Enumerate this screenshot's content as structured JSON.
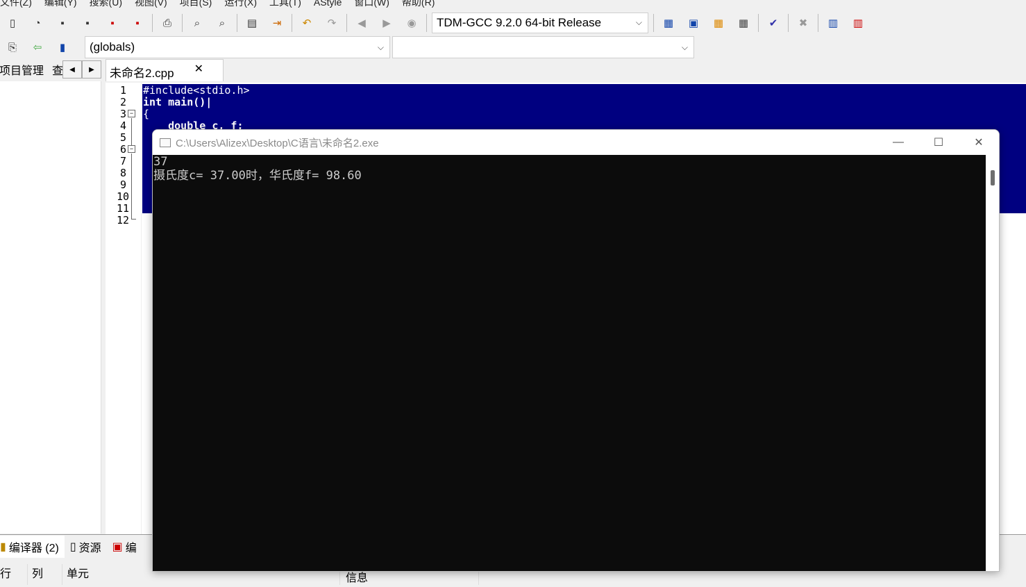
{
  "menu": [
    "文件(Z)",
    "编辑(Y)",
    "搜索(U)",
    "视图(V)",
    "项目(S)",
    "运行(X)",
    "工具(T)",
    "AStyle",
    "窗口(W)",
    "帮助(R)"
  ],
  "toolbar": {
    "compiler": "TDM-GCC 9.2.0 64-bit Release",
    "scope": "(globals)"
  },
  "left_panel": {
    "tab_project": "项目管理",
    "tab_class_partial": "查"
  },
  "editor": {
    "tab_title": "未命名2.cpp",
    "close_glyph": "✕",
    "line_numbers": [
      "1",
      "2",
      "3",
      "4",
      "5",
      "6",
      "7",
      "8",
      "9",
      "10",
      "11",
      "12"
    ],
    "code_lines": [
      "#include<stdio.h>",
      "int main()|",
      "{",
      "    double c, f;",
      "",
      "",
      "",
      "",
      "",
      "",
      "",
      "}"
    ]
  },
  "bottom": {
    "tab_compiler": "编译器 (2)",
    "tab_resources": "资源",
    "tab_compile_partial": "编",
    "col_row": "行",
    "col_col": "列",
    "col_unit": "单元",
    "col_info_partial": "信息"
  },
  "console": {
    "title": "C:\\Users\\Alizex\\Desktop\\C语言\\未命名2.exe",
    "lines": [
      "37",
      "摄氏度c= 37.00时，华氏度f= 98.60"
    ]
  }
}
